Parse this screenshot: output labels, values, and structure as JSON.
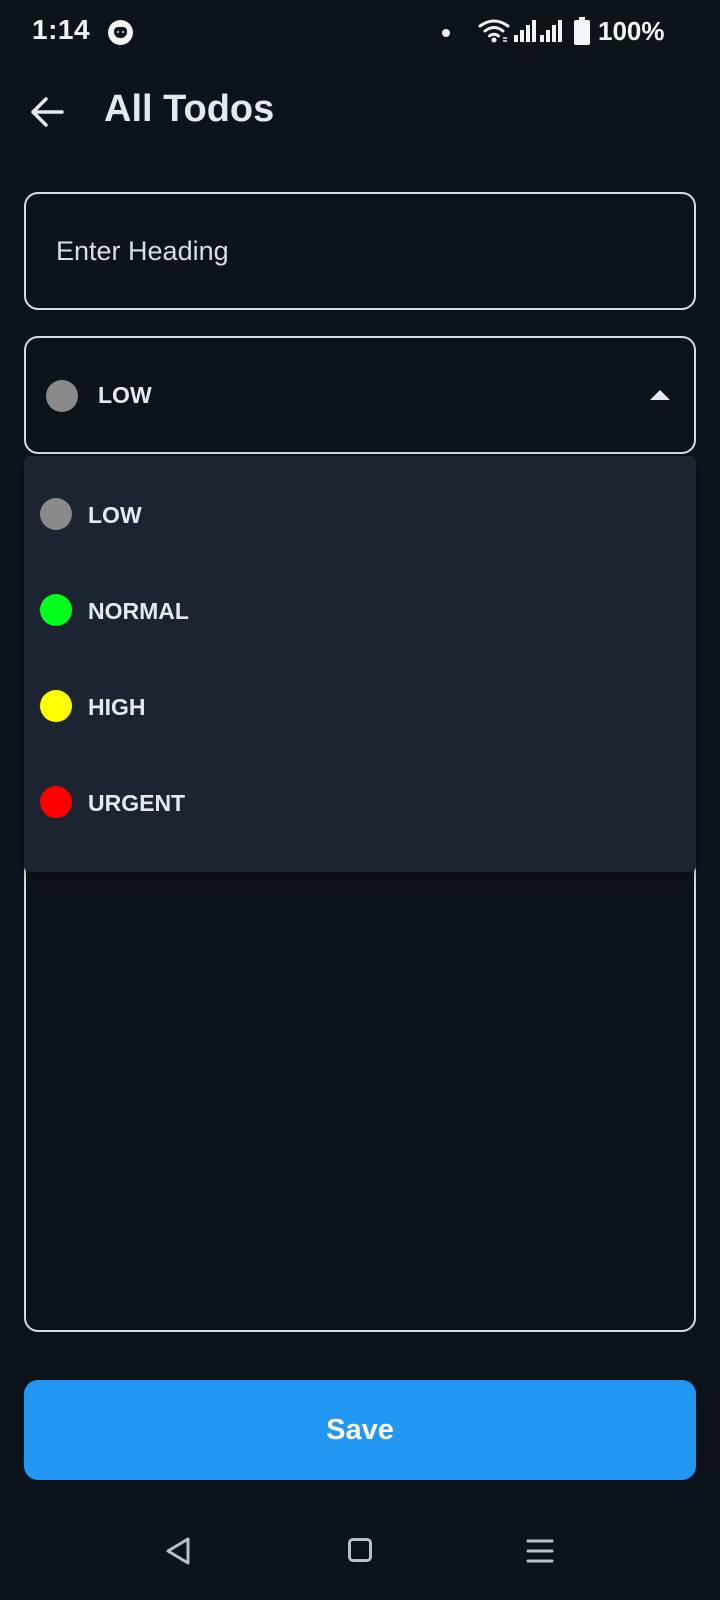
{
  "status_bar": {
    "time": "1:14",
    "battery": "100%",
    "icons": [
      "cat-icon",
      "dot-icon",
      "wifi-icon",
      "signal-icon",
      "signal-icon",
      "battery-icon"
    ]
  },
  "header": {
    "title": "All Todos",
    "back_icon": "arrow-left-icon"
  },
  "form": {
    "heading_placeholder": "Enter Heading",
    "heading_value": "",
    "priority": {
      "selected_label": "LOW",
      "selected_color": "#8a8a8a",
      "open": true
    },
    "description_value": ""
  },
  "priority_options": [
    {
      "label": "LOW",
      "color": "#8a8a8a"
    },
    {
      "label": "NORMAL",
      "color": "#00ff1a"
    },
    {
      "label": "HIGH",
      "color": "#ffff00"
    },
    {
      "label": "URGENT",
      "color": "#ff0000"
    }
  ],
  "actions": {
    "save_label": "Save",
    "save_color": "#2196f3"
  },
  "nav_bar": {
    "icons": [
      "nav-back-icon",
      "nav-home-icon",
      "nav-recents-icon"
    ]
  }
}
